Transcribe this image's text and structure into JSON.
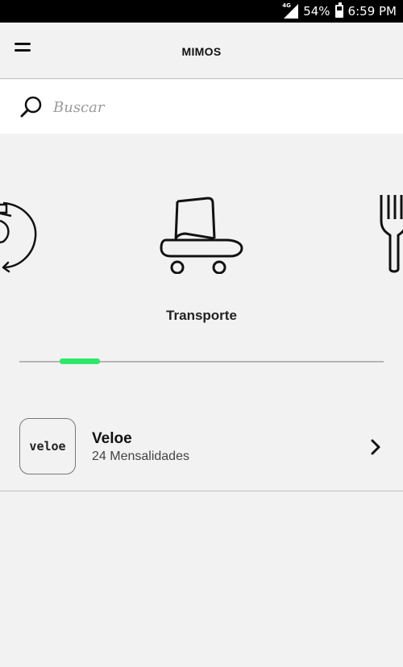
{
  "status_bar": {
    "network": "4G",
    "battery": "54%",
    "time": "6:59 PM"
  },
  "header": {
    "title": "MIMOS",
    "menu_icon": "hamburger-icon"
  },
  "search": {
    "placeholder": "Buscar",
    "icon": "search-icon"
  },
  "categories": {
    "items": [
      {
        "icon": "partial-swirl-icon"
      },
      {
        "label": "Transporte",
        "icon": "skateboard-shoe-icon"
      },
      {
        "icon": "fork-icon"
      }
    ],
    "selected_label": "Transporte",
    "indicator_color": "#2ee86a"
  },
  "partners": [
    {
      "logo_text": "veloe",
      "name": "Veloe",
      "subtitle": "24 Mensalidades",
      "action_icon": "chevron-right-icon"
    }
  ]
}
